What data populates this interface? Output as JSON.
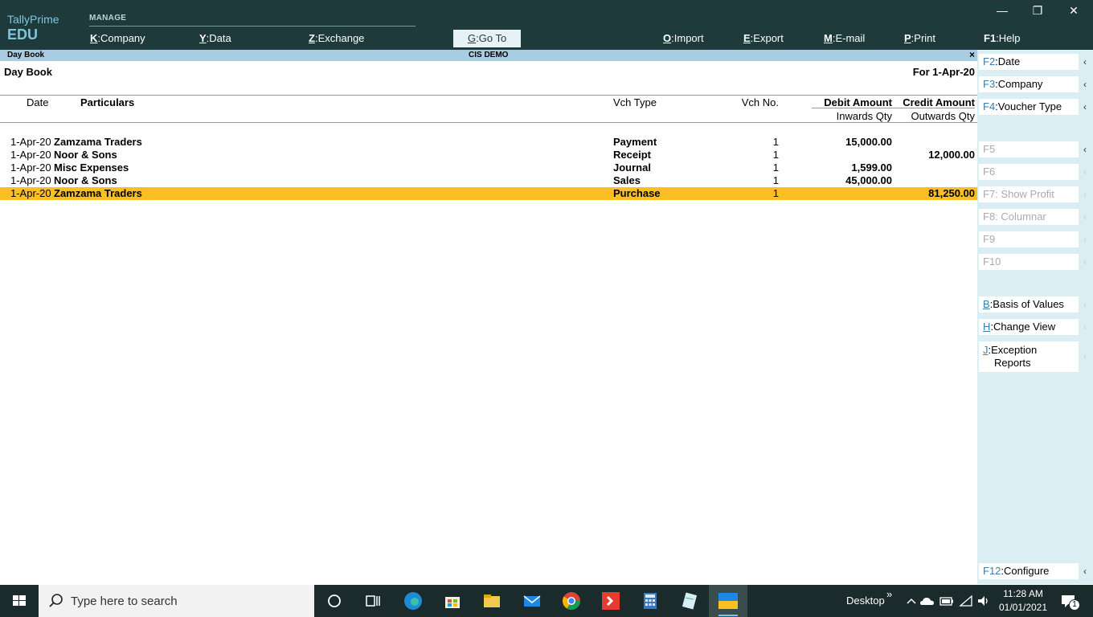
{
  "brand": {
    "line1": "TallyPrime",
    "line2": "EDU"
  },
  "topmenu": {
    "manage_label": "MANAGE",
    "company": {
      "key": "K",
      "label": "Company"
    },
    "data": {
      "key": "Y",
      "label": "Data"
    },
    "exchange": {
      "key": "Z",
      "label": "Exchange"
    },
    "goto": {
      "key": "G",
      "label": "Go To"
    },
    "import": {
      "key": "O",
      "label": "Import"
    },
    "export": {
      "key": "E",
      "label": "Export"
    },
    "email": {
      "key": "M",
      "label": "E-mail"
    },
    "print": {
      "key": "P",
      "label": "Print"
    },
    "help": {
      "key": "F1",
      "label": "Help"
    }
  },
  "window_controls": {
    "minimize": "—",
    "restore": "❐",
    "close": "✕"
  },
  "strip": {
    "left": "Day Book",
    "center": "CIS DEMO",
    "close": "×"
  },
  "report": {
    "title": "Day Book",
    "period": "For 1-Apr-20",
    "headers": {
      "date": "Date",
      "particulars": "Particulars",
      "vch_type": "Vch Type",
      "vch_no": "Vch No.",
      "debit": "Debit Amount",
      "credit": "Credit Amount",
      "inwards": "Inwards Qty",
      "outwards": "Outwards Qty"
    },
    "rows": [
      {
        "date": "1-Apr-20",
        "particulars": "Zamzama Traders",
        "vch_type": "Payment",
        "vch_no": "1",
        "debit": "15,000.00",
        "credit": ""
      },
      {
        "date": "1-Apr-20",
        "particulars": "Noor & Sons",
        "vch_type": "Receipt",
        "vch_no": "1",
        "debit": "",
        "credit": "12,000.00"
      },
      {
        "date": "1-Apr-20",
        "particulars": "Misc Expenses",
        "vch_type": "Journal",
        "vch_no": "1",
        "debit": "1,599.00",
        "credit": ""
      },
      {
        "date": "1-Apr-20",
        "particulars": "Noor & Sons",
        "vch_type": "Sales",
        "vch_no": "1",
        "debit": "45,000.00",
        "credit": ""
      },
      {
        "date": "1-Apr-20",
        "particulars": "Zamzama Traders",
        "vch_type": "Purchase",
        "vch_no": "1",
        "debit": "",
        "credit": "81,250.00"
      }
    ],
    "selected_row": 4
  },
  "side_buttons": {
    "f2": {
      "key": "F2",
      "label": "Date",
      "arrow": "‹"
    },
    "f3": {
      "key": "F3",
      "label": "Company",
      "arrow": "‹"
    },
    "f4": {
      "key": "F4",
      "label": "Voucher Type",
      "arrow": "‹"
    },
    "f5": {
      "key": "F5",
      "label": "",
      "arrow": "‹"
    },
    "f6": {
      "key": "F6",
      "label": "",
      "arrow": "‹"
    },
    "f7": {
      "key": "F7",
      "label": "Show Profit",
      "arrow": "‹"
    },
    "f8": {
      "key": "F8",
      "label": "Columnar",
      "arrow": "‹"
    },
    "f9": {
      "key": "F9",
      "label": "",
      "arrow": "‹"
    },
    "f10": {
      "key": "F10",
      "label": "",
      "arrow": "‹"
    },
    "b": {
      "key": "B",
      "label": "Basis of Values",
      "arrow": "‹"
    },
    "h": {
      "key": "H",
      "label": "Change View",
      "arrow": "‹"
    },
    "j": {
      "key": "J",
      "label_line1": "Exception",
      "label_line2": "Reports",
      "arrow": "‹"
    },
    "f12": {
      "key": "F12",
      "label": "Configure",
      "arrow": "‹"
    }
  },
  "taskbar": {
    "search_placeholder": "Type here to search",
    "desktop_label": "Desktop",
    "chevron": "»",
    "time": "11:28 AM",
    "date": "01/01/2021",
    "notification_count": "1"
  },
  "colors": {
    "header_bg": "#1f3a3a",
    "strip_bg": "#a9cce3",
    "selection": "#fbbf24",
    "panel_bg": "#dbeef4"
  }
}
